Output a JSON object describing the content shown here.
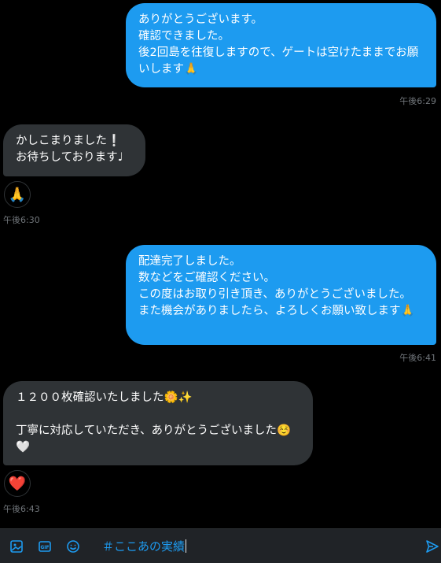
{
  "messages": [
    {
      "text": "ありがとうございます。\n確認できました。\n後2回島を往復しますので、ゲートは空けたままでお願いします🙏",
      "time": "午後6:29"
    },
    {
      "text": "かしこまりました❕\nお待ちしております♩",
      "reaction": "🙏",
      "time": "午後6:30"
    },
    {
      "text": "配達完了しました。\n数などをご確認ください。\nこの度はお取り引き頂き、ありがとうございました。\nまた機会がありましたら、よろしくお願い致します🙏",
      "time": "午後6:41"
    },
    {
      "text": "１２００枚確認いたしました🌼✨\n\n丁寧に対応していただき、ありがとうございました☺️🤍",
      "reaction": "❤️",
      "time": "午後6:43"
    }
  ],
  "composer": {
    "draft": "＃ここあの実績",
    "icons": [
      "image-icon",
      "gif-icon",
      "emoji-icon",
      "send-icon"
    ],
    "accent": "#1d9bf0"
  },
  "colors": {
    "outgoing_bubble": "#1d9bf0",
    "incoming_bubble": "#2f3336",
    "background": "#000000"
  }
}
